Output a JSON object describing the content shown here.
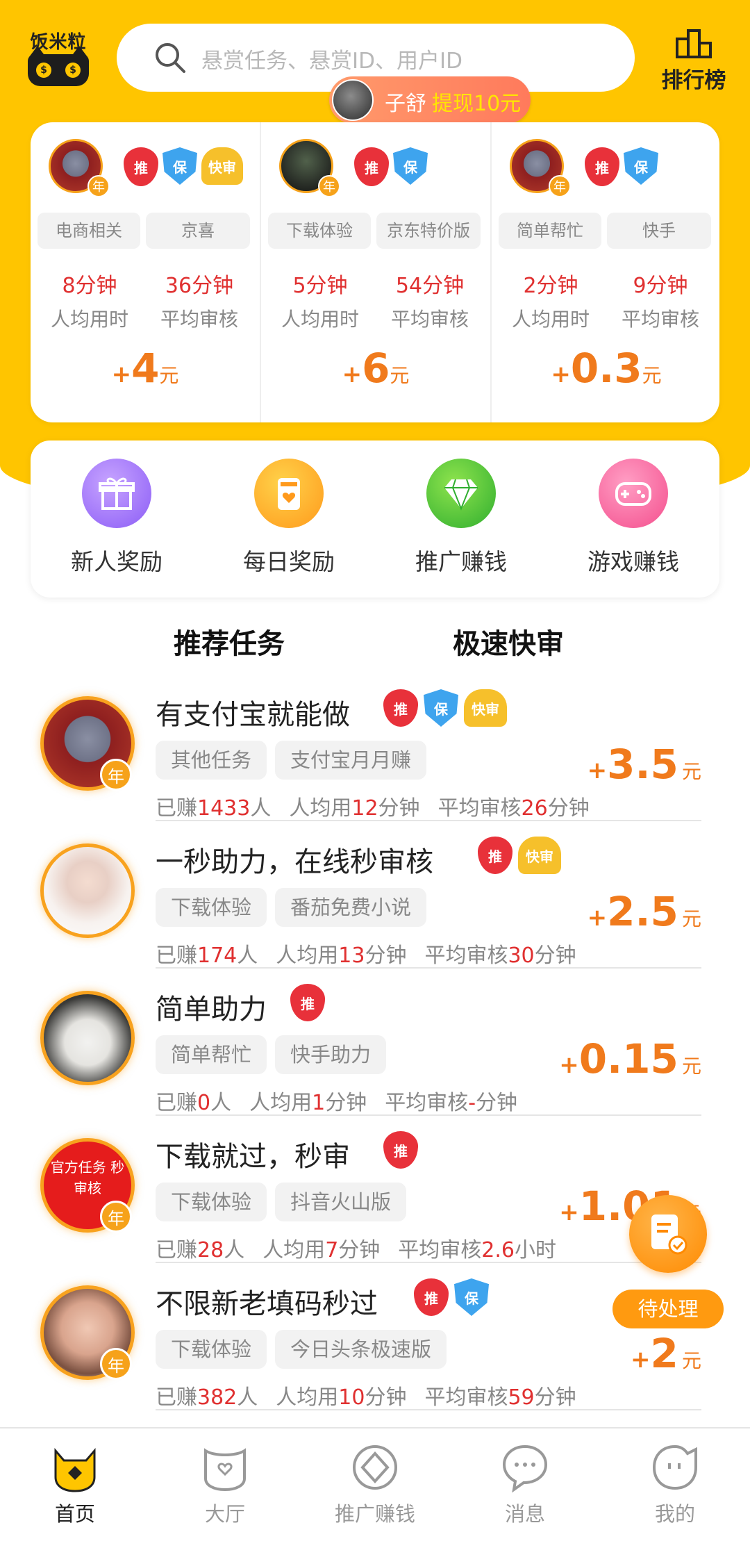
{
  "header": {
    "logo_text": "饭米粒",
    "search_placeholder": "悬赏任务、悬赏ID、用户ID",
    "ranking_label": "排行榜"
  },
  "withdraw_ticker": {
    "name": "子舒",
    "text": "提现10元"
  },
  "featured": [
    {
      "badges": [
        "推",
        "保",
        "快审"
      ],
      "tags": [
        "电商相关",
        "京喜"
      ],
      "avg_time": "8分钟",
      "avg_time_label": "人均用时",
      "review_time": "36分钟",
      "review_label": "平均审核",
      "reward_plus": "+",
      "reward": "4",
      "unit": "元",
      "year_badge": "年"
    },
    {
      "badges": [
        "推",
        "保"
      ],
      "tags": [
        "下载体验",
        "京东特价版"
      ],
      "avg_time": "5分钟",
      "avg_time_label": "人均用时",
      "review_time": "54分钟",
      "review_label": "平均审核",
      "reward_plus": "+",
      "reward": "6",
      "unit": "元",
      "year_badge": "年"
    },
    {
      "badges": [
        "推",
        "保"
      ],
      "tags": [
        "简单帮忙",
        "快手"
      ],
      "avg_time": "2分钟",
      "avg_time_label": "人均用时",
      "review_time": "9分钟",
      "review_label": "平均审核",
      "reward_plus": "+",
      "reward": "0.3",
      "unit": "元",
      "year_badge": "年"
    }
  ],
  "quick_menu": [
    {
      "label": "新人奖励",
      "icon": "gift-icon",
      "color": "#8b5cf6"
    },
    {
      "label": "每日奖励",
      "icon": "daily-card-icon",
      "color": "#ff9a1c"
    },
    {
      "label": "推广赚钱",
      "icon": "diamond-icon",
      "color": "#2fae2f"
    },
    {
      "label": "游戏赚钱",
      "icon": "gamepad-icon",
      "color": "#f44e8d"
    }
  ],
  "tabs": {
    "recommended": "推荐任务",
    "fast_review": "极速快审"
  },
  "tasks": [
    {
      "title": "有支付宝就能做",
      "badges": [
        "推",
        "保",
        "快审"
      ],
      "tags": [
        "其他任务",
        "支付宝月月赚"
      ],
      "earned_prefix": "已赚",
      "earned": "1433",
      "earned_suffix": "人",
      "avg_prefix": "人均用",
      "avg": "12",
      "avg_suffix": "分钟",
      "review_prefix": "平均审核",
      "review": "26",
      "review_suffix": "分钟",
      "reward": "3.5",
      "year_badge": "年"
    },
    {
      "title": "一秒助力，在线秒审核",
      "badges": [
        "推",
        "快审"
      ],
      "tags": [
        "下载体验",
        "番茄免费小说"
      ],
      "earned_prefix": "已赚",
      "earned": "174",
      "earned_suffix": "人",
      "avg_prefix": "人均用",
      "avg": "13",
      "avg_suffix": "分钟",
      "review_prefix": "平均审核",
      "review": "30",
      "review_suffix": "分钟",
      "reward": "2.5",
      "year_badge": ""
    },
    {
      "title": "简单助力",
      "badges": [
        "推"
      ],
      "tags": [
        "简单帮忙",
        "快手助力"
      ],
      "earned_prefix": "已赚",
      "earned": "0",
      "earned_suffix": "人",
      "avg_prefix": "人均用",
      "avg": "1",
      "avg_suffix": "分钟",
      "review_prefix": "平均审核",
      "review": "-",
      "review_suffix": "分钟",
      "reward": "0.15",
      "year_badge": ""
    },
    {
      "title": "下载就过，秒审",
      "badges": [
        "推"
      ],
      "tags": [
        "下载体验",
        "抖音火山版"
      ],
      "earned_prefix": "已赚",
      "earned": "28",
      "earned_suffix": "人",
      "avg_prefix": "人均用",
      "avg": "7",
      "avg_suffix": "分钟",
      "review_prefix": "平均审核",
      "review": "2.6",
      "review_suffix": "小时",
      "reward": "1.01",
      "year_badge": "年",
      "avatar_text": "官方任务 秒 审核"
    },
    {
      "title": "不限新老填码秒过",
      "badges": [
        "推",
        "保"
      ],
      "tags": [
        "下载体验",
        "今日头条极速版"
      ],
      "earned_prefix": "已赚",
      "earned": "382",
      "earned_suffix": "人",
      "avg_prefix": "人均用",
      "avg": "10",
      "avg_suffix": "分钟",
      "review_prefix": "平均审核",
      "review": "59",
      "review_suffix": "分钟",
      "reward": "2",
      "year_badge": "年"
    }
  ],
  "reward_unit": "元",
  "reward_plus": "+",
  "pending_label": "待处理",
  "bottom_nav": [
    {
      "label": "首页",
      "icon": "home-cat-icon",
      "active": true
    },
    {
      "label": "大厅",
      "icon": "hall-icon",
      "active": false
    },
    {
      "label": "推广赚钱",
      "icon": "promote-icon",
      "active": false
    },
    {
      "label": "消息",
      "icon": "message-icon",
      "active": false
    },
    {
      "label": "我的",
      "icon": "profile-icon",
      "active": false
    }
  ],
  "colors": {
    "brand_yellow": "#FFC500",
    "reward_orange": "#f07a1c",
    "stat_red": "#e03030"
  }
}
